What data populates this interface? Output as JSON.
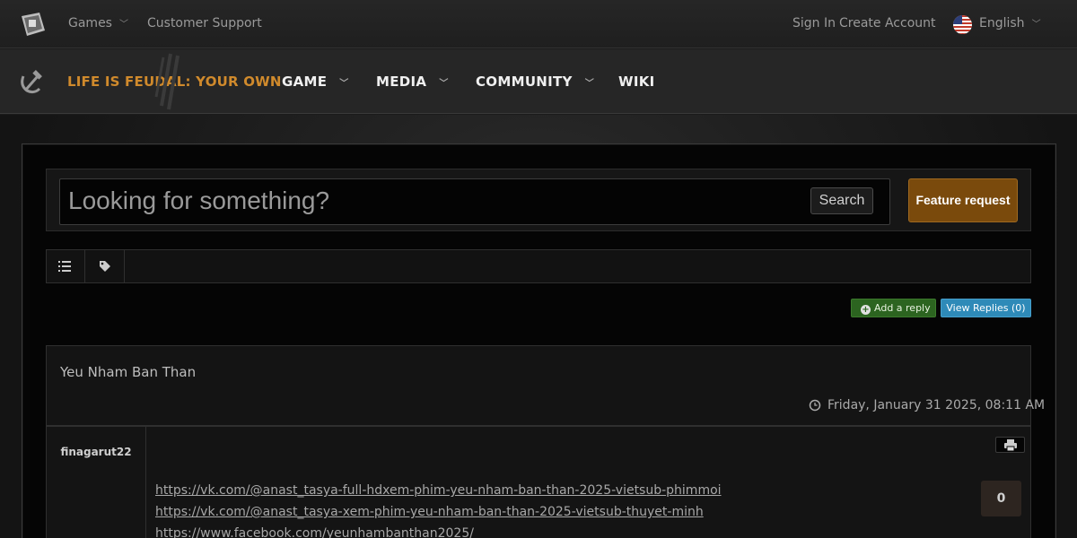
{
  "topbar": {
    "games_label": "Games",
    "support_label": "Customer Support",
    "signin_label": "Sign In",
    "create_label": "Create Account",
    "language_label": "English"
  },
  "navbar": {
    "brand": "LIFE IS FEUDAL: YOUR OWN",
    "items": [
      {
        "label": "GAME"
      },
      {
        "label": "MEDIA"
      },
      {
        "label": "COMMUNITY"
      },
      {
        "label": "WIKI"
      }
    ]
  },
  "search": {
    "placeholder": "Looking for something?",
    "button_label": "Search"
  },
  "feature_request_label": "Feature request",
  "actions": {
    "add_reply_label": "Add a reply",
    "view_replies_label": "View Replies (0)"
  },
  "post": {
    "title": "Yeu Nham Ban Than",
    "date": "Friday, January 31 2025, 08:11 AM",
    "author": "finagarut22",
    "links": [
      "https://vk.com/@anast_tasya-full-hdxem-phim-yeu-nham-ban-than-2025-vietsub-phimmoi",
      "https://vk.com/@anast_tasya-xem-phim-yeu-nham-ban-than-2025-vietsub-thuyet-minh",
      "https://www.facebook.com/yeunhambanthan2025/"
    ],
    "votes": "0"
  },
  "colors": {
    "brand": "#d08a2c",
    "feature_button": "#7a4a0c",
    "reply_button": "#2c6420",
    "view_button": "#2e8ab8"
  }
}
